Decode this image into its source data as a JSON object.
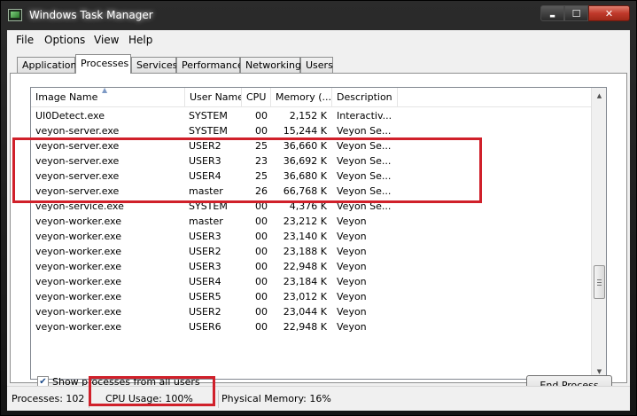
{
  "window": {
    "title": "Windows Task Manager"
  },
  "caption": {
    "minimize": "▬",
    "maximize": "☐",
    "close": "✕"
  },
  "menu": {
    "file": "File",
    "options": "Options",
    "view": "View",
    "help": "Help"
  },
  "tabs": {
    "applications": "Applications",
    "processes": "Processes",
    "services": "Services",
    "performance": "Performance",
    "networking": "Networking",
    "users": "Users",
    "active": "Processes"
  },
  "columns": {
    "name": "Image Name",
    "user": "User Name",
    "cpu": "CPU",
    "memory": "Memory (...",
    "description": "Description"
  },
  "rows": [
    {
      "name": "UI0Detect.exe",
      "user": "SYSTEM",
      "cpu": "00",
      "memory": "2,152 K",
      "description": "Interactiv..."
    },
    {
      "name": "veyon-server.exe",
      "user": "SYSTEM",
      "cpu": "00",
      "memory": "15,244 K",
      "description": "Veyon Se..."
    },
    {
      "name": "veyon-server.exe",
      "user": "USER2",
      "cpu": "25",
      "memory": "36,660 K",
      "description": "Veyon Se..."
    },
    {
      "name": "veyon-server.exe",
      "user": "USER3",
      "cpu": "23",
      "memory": "36,692 K",
      "description": "Veyon Se..."
    },
    {
      "name": "veyon-server.exe",
      "user": "USER4",
      "cpu": "25",
      "memory": "36,680 K",
      "description": "Veyon Se..."
    },
    {
      "name": "veyon-server.exe",
      "user": "master",
      "cpu": "26",
      "memory": "66,768 K",
      "description": "Veyon Se..."
    },
    {
      "name": "veyon-service.exe",
      "user": "SYSTEM",
      "cpu": "00",
      "memory": "4,376 K",
      "description": "Veyon Se..."
    },
    {
      "name": "veyon-worker.exe",
      "user": "master",
      "cpu": "00",
      "memory": "23,212 K",
      "description": "Veyon"
    },
    {
      "name": "veyon-worker.exe",
      "user": "USER3",
      "cpu": "00",
      "memory": "23,140 K",
      "description": "Veyon"
    },
    {
      "name": "veyon-worker.exe",
      "user": "USER2",
      "cpu": "00",
      "memory": "23,188 K",
      "description": "Veyon"
    },
    {
      "name": "veyon-worker.exe",
      "user": "USER3",
      "cpu": "00",
      "memory": "22,948 K",
      "description": "Veyon"
    },
    {
      "name": "veyon-worker.exe",
      "user": "USER4",
      "cpu": "00",
      "memory": "23,184 K",
      "description": "Veyon"
    },
    {
      "name": "veyon-worker.exe",
      "user": "USER5",
      "cpu": "00",
      "memory": "23,012 K",
      "description": "Veyon"
    },
    {
      "name": "veyon-worker.exe",
      "user": "USER2",
      "cpu": "00",
      "memory": "23,044 K",
      "description": "Veyon"
    },
    {
      "name": "veyon-worker.exe",
      "user": "USER6",
      "cpu": "00",
      "memory": "22,948 K",
      "description": "Veyon"
    }
  ],
  "show_all": {
    "label": "Show processes from all users",
    "checked": true
  },
  "end_process": "End Process",
  "status": {
    "processes": "Processes: 102",
    "cpu": "CPU Usage: 100%",
    "memory": "Physical Memory: 16%"
  },
  "colors": {
    "highlight": "#d0202a",
    "close_button": "#c0392b"
  }
}
